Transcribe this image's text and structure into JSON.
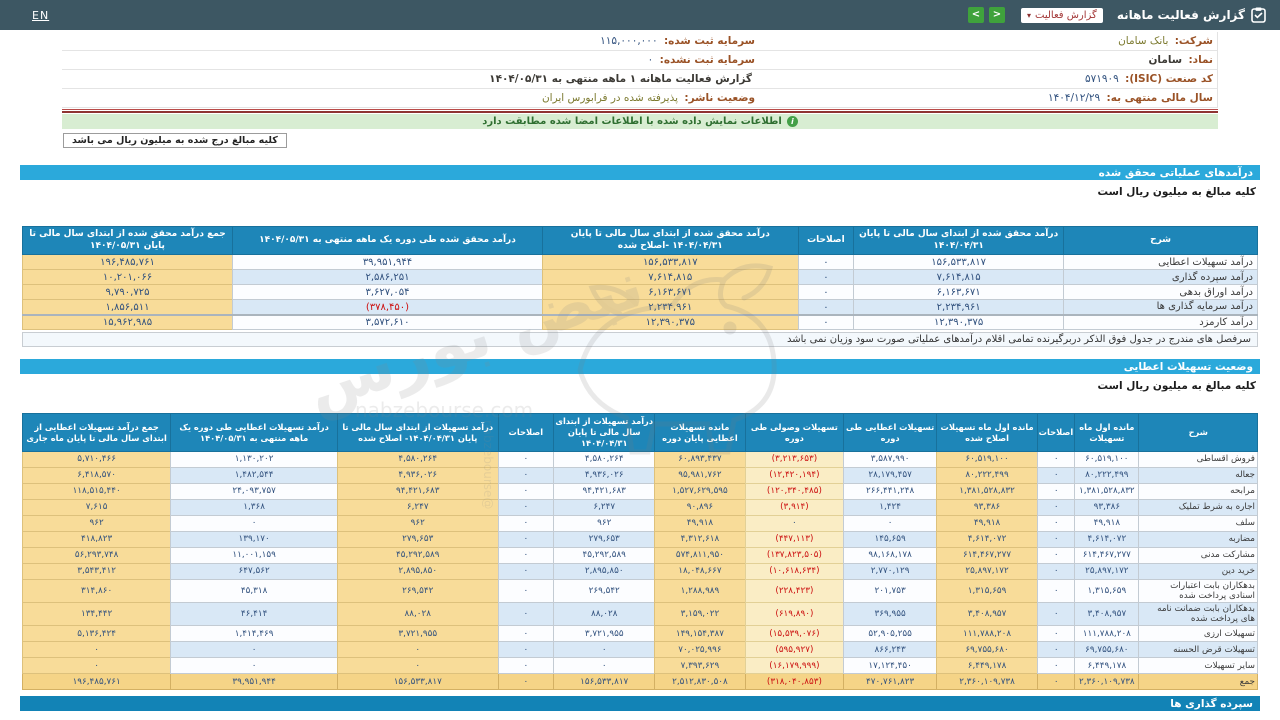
{
  "navbar": {
    "en": "EN",
    "title": "گزارش فعالیت ماهانه",
    "dropdown": "گزارش فعالیت",
    "caret": "▾",
    "prev": "<",
    "next": ">"
  },
  "info": {
    "right": [
      {
        "label": "شرکت:",
        "value": "بانک سامان"
      },
      {
        "label": "نماد:",
        "value": "سامان"
      },
      {
        "label": "کد صنعت (ISIC):",
        "value": "۵۷۱۹۰۹"
      },
      {
        "label": "سال مالی منتهی به:",
        "value": "۱۴۰۴/۱۲/۲۹"
      }
    ],
    "mid": [
      {
        "label": "سرمایه ثبت شده:",
        "value": "۱۱۵,۰۰۰,۰۰۰"
      },
      {
        "label": "سرمایه ثبت نشده:",
        "value": "۰"
      },
      {
        "label": "",
        "value": "گزارش فعالیت ماهانه ۱ ماهه منتهی به ۱۴۰۴/۰۵/۳۱"
      },
      {
        "label": "وضعیت ناشر:",
        "value": "پذیرفته شده در فرابورس ایران"
      }
    ]
  },
  "notice": "اطلاعات نمایش داده شده با اطلاعات امضا شده مطابقت دارد",
  "million_note": "کلیه مبالغ درج شده به میلیون ریال می باشد",
  "section1": {
    "title": "درآمدهای عملیاتی محقق شده",
    "subtitle": "کلیه مبالغ به میلیون ریال است"
  },
  "table1": {
    "headers": [
      "شرح",
      "درآمد محقق شده از ابتدای سال مالی تا پایان ۱۴۰۴/۰۴/۳۱",
      "اصلاحات",
      "درآمد محقق شده از ابتدای سال مالی تا پایان ۱۴۰۴/۰۴/۳۱ -اصلاح شده",
      "درآمد محقق شده طی دوره یک ماهه منتهی به ۱۴۰۴/۰۵/۳۱",
      "جمع درآمد محقق شده از ابتدای سال مالی تا پایان ۱۴۰۴/۰۵/۳۱"
    ],
    "rows": [
      [
        "درآمد تسهیلات اعطایی",
        "۱۵۶,۵۳۳,۸۱۷",
        "۰",
        "۱۵۶,۵۳۳,۸۱۷",
        "۳۹,۹۵۱,۹۴۴",
        "۱۹۶,۴۸۵,۷۶۱"
      ],
      [
        "درآمد سپرده گذاری",
        "۷,۶۱۴,۸۱۵",
        "۰",
        "۷,۶۱۴,۸۱۵",
        "۲,۵۸۶,۲۵۱",
        "۱۰,۲۰۱,۰۶۶"
      ],
      [
        "درآمد اوراق بدهی",
        "۶,۱۶۳,۶۷۱",
        "۰",
        "۶,۱۶۳,۶۷۱",
        "۳,۶۲۷,۰۵۴",
        "۹,۷۹۰,۷۲۵"
      ],
      [
        "درآمد سرمایه گذاری ها",
        "۲,۲۳۴,۹۶۱",
        "۰",
        "۲,۲۳۴,۹۶۱",
        "(۳۷۸,۴۵۰)",
        "۱,۸۵۶,۵۱۱"
      ],
      [
        "درآمد کارمزد",
        "۱۲,۳۹۰,۳۷۵",
        "۰",
        "۱۲,۳۹۰,۳۷۵",
        "۳,۵۷۲,۶۱۰",
        "۱۵,۹۶۲,۹۸۵"
      ]
    ],
    "footnote": "سرفصل های مندرج در جدول فوق الذکر دربرگیرنده تمامی اقلام درآمدهای عملیاتی صورت سود وزیان نمی باشد"
  },
  "section2": {
    "title": "وضعیت تسهیلات اعطایی",
    "subtitle": "کلیه مبالغ به میلیون ریال است"
  },
  "table2": {
    "headers": [
      "شرح",
      "مانده اول ماه تسهیلات",
      "اصلاحات",
      "مانده اول ماه تسهیلات اصلاح شده",
      "تسهیلات اعطایی طی دوره",
      "تسهیلات وصولی طی دوره",
      "مانده تسهیلات اعطایی پایان دوره",
      "درآمد تسهیلات از ابتدای سال مالی تا پایان ۱۴۰۴/۰۴/۳۱",
      "اصلاحات",
      "درآمد تسهیلات از ابتدای سال مالی تا پایان ۱۴۰۴/۰۴/۳۱- اصلاح شده",
      "درآمد تسهیلات اعطایی طی دوره یک ماهه منتهی به ۱۴۰۴/۰۵/۳۱",
      "جمع درآمد تسهیلات اعطایی از ابتدای سال مالی تا پایان ماه جاری"
    ],
    "rows": [
      [
        "فروش اقساطی",
        "۶۰,۵۱۹,۱۰۰",
        "۰",
        "۶۰,۵۱۹,۱۰۰",
        "۳,۵۸۷,۹۹۰",
        "(۳,۲۱۳,۶۵۳)",
        "۶۰,۸۹۳,۴۳۷",
        "۴,۵۸۰,۲۶۴",
        "۰",
        "۴,۵۸۰,۲۶۴",
        "۱,۱۳۰,۲۰۲",
        "۵,۷۱۰,۴۶۶"
      ],
      [
        "جعاله",
        "۸۰,۲۲۲,۴۹۹",
        "۰",
        "۸۰,۲۲۲,۴۹۹",
        "۲۸,۱۷۹,۴۵۷",
        "(۱۲,۴۲۰,۱۹۴)",
        "۹۵,۹۸۱,۷۶۲",
        "۴,۹۳۶,۰۲۶",
        "۰",
        "۴,۹۳۶,۰۲۶",
        "۱,۴۸۲,۵۴۴",
        "۶,۴۱۸,۵۷۰"
      ],
      [
        "مرابحه",
        "۱,۳۸۱,۵۲۸,۸۳۲",
        "۰",
        "۱,۳۸۱,۵۲۸,۸۳۲",
        "۲۶۶,۴۴۱,۲۴۸",
        "(۱۲۰,۳۴۰,۴۸۵)",
        "۱,۵۲۷,۶۲۹,۵۹۵",
        "۹۴,۴۲۱,۶۸۳",
        "۰",
        "۹۴,۴۲۱,۶۸۳",
        "۲۴,۰۹۳,۷۵۷",
        "۱۱۸,۵۱۵,۴۴۰"
      ],
      [
        "اجاره به شرط تملیک",
        "۹۳,۳۸۶",
        "۰",
        "۹۳,۳۸۶",
        "۱,۴۲۴",
        "(۳,۹۱۴)",
        "۹۰,۸۹۶",
        "۶,۲۴۷",
        "۰",
        "۶,۲۴۷",
        "۱,۳۶۸",
        "۷,۶۱۵"
      ],
      [
        "سلف",
        "۴۹,۹۱۸",
        "۰",
        "۴۹,۹۱۸",
        "۰",
        "۰",
        "۴۹,۹۱۸",
        "۹۶۲",
        "۰",
        "۹۶۲",
        "۰",
        "۹۶۲"
      ],
      [
        "مضاربه",
        "۴,۶۱۴,۰۷۲",
        "۰",
        "۴,۶۱۴,۰۷۲",
        "۱۴۵,۶۵۹",
        "(۴۴۷,۱۱۳)",
        "۴,۳۱۲,۶۱۸",
        "۲۷۹,۶۵۳",
        "۰",
        "۲۷۹,۶۵۳",
        "۱۳۹,۱۷۰",
        "۴۱۸,۸۲۳"
      ],
      [
        "مشارکت مدنی",
        "۶۱۴,۴۶۷,۲۷۷",
        "۰",
        "۶۱۴,۴۶۷,۲۷۷",
        "۹۸,۱۶۸,۱۷۸",
        "(۱۳۷,۸۲۳,۵۰۵)",
        "۵۷۴,۸۱۱,۹۵۰",
        "۴۵,۲۹۲,۵۸۹",
        "۰",
        "۴۵,۲۹۲,۵۸۹",
        "۱۱,۰۰۱,۱۵۹",
        "۵۶,۲۹۳,۷۴۸"
      ],
      [
        "خرید دین",
        "۲۵,۸۹۷,۱۷۲",
        "۰",
        "۲۵,۸۹۷,۱۷۲",
        "۲,۷۷۰,۱۲۹",
        "(۱۰,۶۱۸,۶۳۴)",
        "۱۸,۰۴۸,۶۶۷",
        "۲,۸۹۵,۸۵۰",
        "۰",
        "۲,۸۹۵,۸۵۰",
        "۶۴۷,۵۶۲",
        "۳,۵۴۳,۴۱۲"
      ],
      [
        "بدهکاران بابت اعتبارات اسنادی پرداخت شده",
        "۱,۳۱۵,۶۵۹",
        "۰",
        "۱,۳۱۵,۶۵۹",
        "۲۰۱,۷۵۳",
        "(۲۲۸,۴۲۳)",
        "۱,۲۸۸,۹۸۹",
        "۲۶۹,۵۴۲",
        "۰",
        "۲۶۹,۵۴۲",
        "۴۵,۳۱۸",
        "۳۱۴,۸۶۰"
      ],
      [
        "بدهکاران بابت ضمانت نامه های پرداخت شده",
        "۳,۴۰۸,۹۵۷",
        "۰",
        "۳,۴۰۸,۹۵۷",
        "۳۶۹,۹۵۵",
        "(۶۱۹,۸۹۰)",
        "۳,۱۵۹,۰۲۲",
        "۸۸,۰۲۸",
        "۰",
        "۸۸,۰۲۸",
        "۴۶,۴۱۴",
        "۱۳۴,۴۴۲"
      ],
      [
        "تسهیلات ارزی",
        "۱۱۱,۷۸۸,۲۰۸",
        "۰",
        "۱۱۱,۷۸۸,۲۰۸",
        "۵۲,۹۰۵,۲۵۵",
        "(۱۵,۵۳۹,۰۷۶)",
        "۱۴۹,۱۵۴,۳۸۷",
        "۳,۷۲۱,۹۵۵",
        "۰",
        "۳,۷۲۱,۹۵۵",
        "۱,۴۱۴,۴۶۹",
        "۵,۱۳۶,۴۲۴"
      ],
      [
        "تسهیلات قرض الحسنه",
        "۶۹,۷۵۵,۶۸۰",
        "۰",
        "۶۹,۷۵۵,۶۸۰",
        "۸۶۶,۲۴۳",
        "(۵۹۵,۹۲۷)",
        "۷۰,۰۲۵,۹۹۶",
        "۰",
        "۰",
        "۰",
        "۰",
        "۰"
      ],
      [
        "سایر تسهیلات",
        "۶,۴۴۹,۱۷۸",
        "۰",
        "۶,۴۴۹,۱۷۸",
        "۱۷,۱۲۴,۴۵۰",
        "(۱۶,۱۷۹,۹۹۹)",
        "۷,۳۹۳,۶۲۹",
        "۰",
        "۰",
        "۰",
        "۰",
        "۰"
      ],
      [
        "جمع",
        "۲,۳۶۰,۱۰۹,۷۳۸",
        "۰",
        "۲,۳۶۰,۱۰۹,۷۳۸",
        "۴۷۰,۷۶۱,۸۲۳",
        "(۳۱۸,۰۴۰,۸۵۳)",
        "۲,۵۱۲,۸۳۰,۵۰۸",
        "۱۵۶,۵۳۳,۸۱۷",
        "۰",
        "۱۵۶,۵۳۳,۸۱۷",
        "۳۹,۹۵۱,۹۴۴",
        "۱۹۶,۴۸۵,۷۶۱"
      ]
    ]
  },
  "section3": {
    "title": "سپرده گذاری ها"
  },
  "watermark": {
    "brand": "نبض بورس",
    "site": "nabzebourse.com",
    "handle": "@nabzebourse"
  },
  "colors": {
    "accent_blue": "#2BA9DB",
    "header_blue": "#1E86B8",
    "navbar": "#3D5763",
    "yellow_cell": "#F8DC99",
    "negative": "#CC1111",
    "notice_green": "#D8EDD2"
  }
}
